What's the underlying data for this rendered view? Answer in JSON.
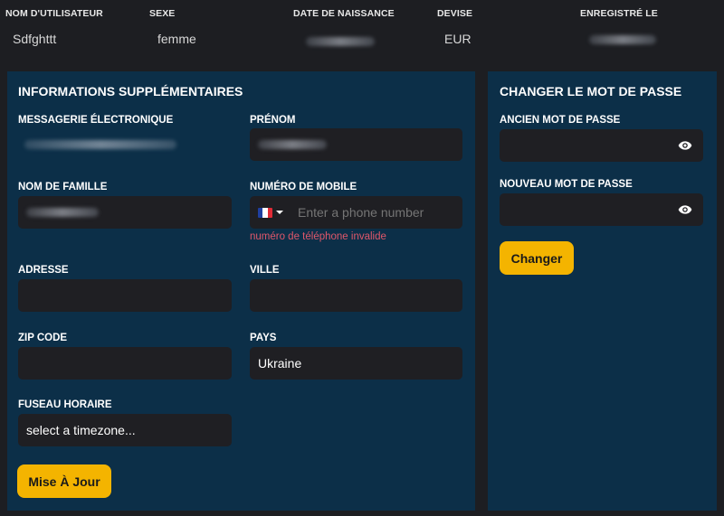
{
  "user_info": {
    "columns": [
      {
        "header": "NOM D'UTILISATEUR",
        "value": "Sdfghttt"
      },
      {
        "header": "SEXE",
        "value": "femme"
      },
      {
        "header": "DATE DE NAISSANCE",
        "value": ""
      },
      {
        "header": "DEVISE",
        "value": "EUR"
      },
      {
        "header": "ENREGISTRÉ LE",
        "value": ""
      }
    ]
  },
  "additional_info": {
    "title": "INFORMATIONS SUPPLÉMENTAIRES",
    "email_label": "MESSAGERIE ÉLECTRONIQUE",
    "first_name_label": "PRÉNOM",
    "last_name_label": "NOM DE FAMILLE",
    "mobile_label": "NUMÉRO DE MOBILE",
    "mobile_placeholder": "Enter a phone number",
    "mobile_error": "numéro de téléphone invalide",
    "mobile_country": "France",
    "address_label": "ADRESSE",
    "address_value": "",
    "city_label": "VILLE",
    "city_value": "",
    "zip_label": "ZIP CODE",
    "zip_value": "",
    "country_label": "PAYS",
    "country_value": "Ukraine",
    "timezone_label": "FUSEAU HORAIRE",
    "timezone_value": "select a timezone...",
    "update_button": "Mise À Jour"
  },
  "change_password": {
    "title": "CHANGER LE MOT DE PASSE",
    "old_password_label": "ANCIEN MOT DE PASSE",
    "new_password_label": "NOUVEAU MOT DE PASSE",
    "change_button": "Changer"
  },
  "colors": {
    "panel_bg": "#0c2f48",
    "page_bg": "#1d1e22",
    "input_bg": "#1f1f23",
    "accent": "#f4b400",
    "error": "#e0576a"
  },
  "icons": {
    "password_visibility": "eye-icon",
    "country_flag": "france-flag-icon",
    "dropdown": "caret-down-icon"
  }
}
